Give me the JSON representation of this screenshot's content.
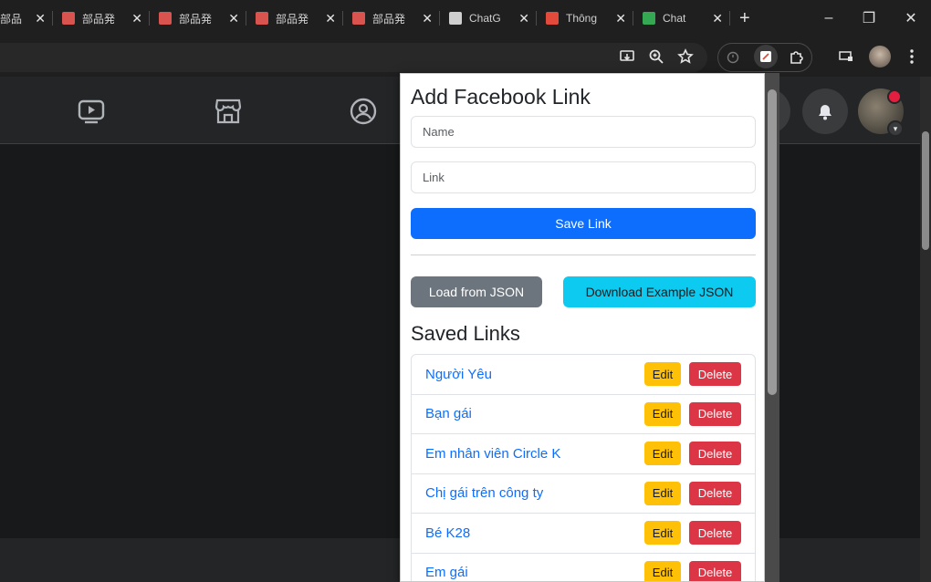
{
  "browser": {
    "tabs": [
      {
        "title": "部品",
        "favicon": "generic-icon",
        "color": "#888888"
      },
      {
        "title": "部品発",
        "favicon": "bird-logo-icon",
        "color": "#d9534f"
      },
      {
        "title": "部品発",
        "favicon": "bird-logo-icon",
        "color": "#d9534f"
      },
      {
        "title": "部品発",
        "favicon": "bird-logo-icon",
        "color": "#d9534f"
      },
      {
        "title": "部品発",
        "favicon": "bird-logo-icon",
        "color": "#d9534f"
      },
      {
        "title": "ChatG",
        "favicon": "chatgpt-icon",
        "color": "#cfcfcf"
      },
      {
        "title": "Thông",
        "favicon": "chart-icon",
        "color": "#e24b3b"
      },
      {
        "title": "Chat",
        "favicon": "chat-icon",
        "color": "#34a853"
      }
    ],
    "new_tab": "+",
    "controls": {
      "minimize": "–",
      "restore": "❐",
      "close": "✕"
    }
  },
  "popup": {
    "title": "Add Facebook Link",
    "name_placeholder": "Name",
    "link_placeholder": "Link",
    "save_label": "Save Link",
    "load_label": "Load from JSON",
    "download_label": "Download Example JSON",
    "saved_title": "Saved Links",
    "edit_label": "Edit",
    "delete_label": "Delete",
    "links": [
      {
        "name": "Người Yêu"
      },
      {
        "name": "Bạn gái"
      },
      {
        "name": "Em nhân viên Circle K"
      },
      {
        "name": "Chị gái trên công ty"
      },
      {
        "name": "Bé K28"
      },
      {
        "name": "Em gái"
      }
    ]
  },
  "colors": {
    "primary": "#0d6efd",
    "secondary": "#6c757d",
    "info": "#0dcaf0",
    "warning": "#ffc107",
    "danger": "#dc3545",
    "fb_dark": "#242526"
  }
}
